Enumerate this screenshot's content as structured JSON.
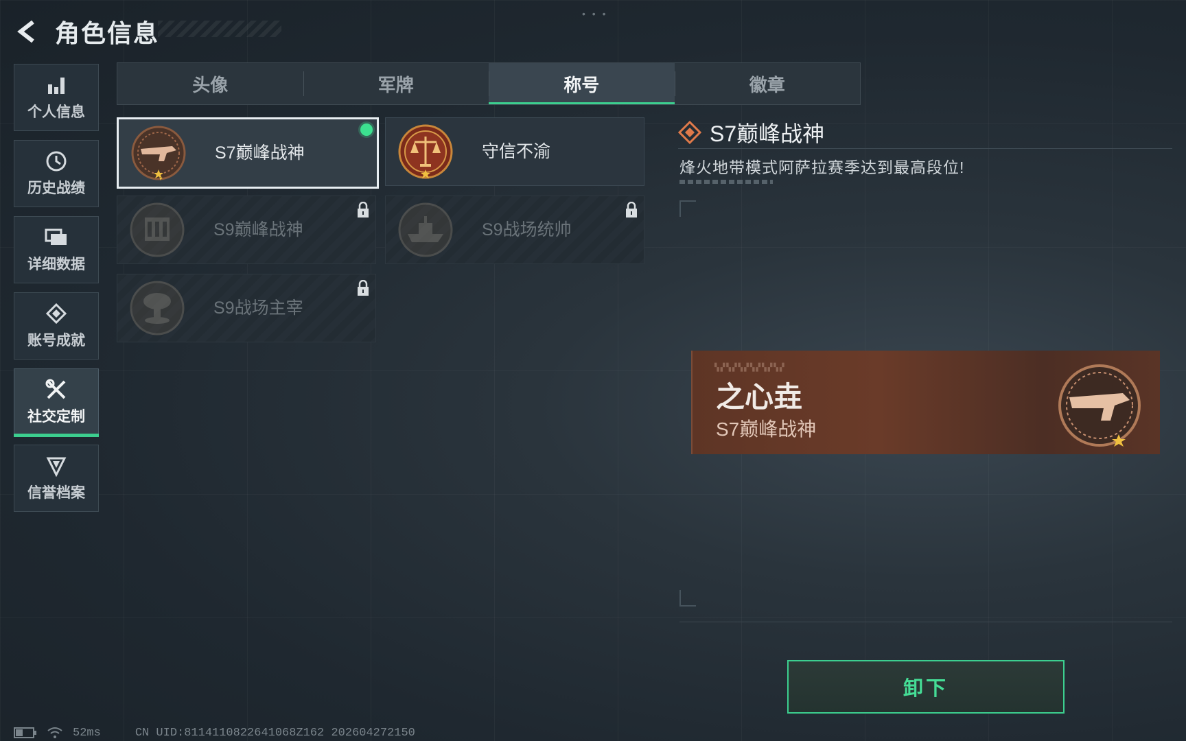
{
  "header": {
    "title": "角色信息"
  },
  "sidebar": {
    "items": [
      {
        "label": "个人信息",
        "icon": "bar-chart-icon",
        "active": false
      },
      {
        "label": "历史战绩",
        "icon": "clock-icon",
        "active": false
      },
      {
        "label": "详细数据",
        "icon": "folder-icon",
        "active": false
      },
      {
        "label": "账号成就",
        "icon": "achievement-icon",
        "active": false
      },
      {
        "label": "社交定制",
        "icon": "tools-icon",
        "active": true
      },
      {
        "label": "信誉档案",
        "icon": "shield-icon",
        "active": false
      }
    ]
  },
  "tabs": [
    {
      "label": "头像",
      "active": false
    },
    {
      "label": "军牌",
      "active": false
    },
    {
      "label": "称号",
      "active": true
    },
    {
      "label": "徽章",
      "active": false
    }
  ],
  "titles": [
    {
      "name": "S7巅峰战神",
      "icon": "weapon-badge-icon",
      "selected": true,
      "equipped": true,
      "locked": false
    },
    {
      "name": "守信不渝",
      "icon": "scales-badge-icon",
      "selected": false,
      "equipped": false,
      "locked": false
    },
    {
      "name": "S9巅峰战神",
      "icon": "building-badge-icon",
      "selected": false,
      "equipped": false,
      "locked": true
    },
    {
      "name": "S9战场统帅",
      "icon": "ship-badge-icon",
      "selected": false,
      "equipped": false,
      "locked": true
    },
    {
      "name": "S9战场主宰",
      "icon": "explosion-badge-icon",
      "selected": false,
      "equipped": false,
      "locked": true
    }
  ],
  "detail": {
    "title": "S7巅峰战神",
    "description": "烽火地带模式阿萨拉赛季达到最高段位!"
  },
  "preview": {
    "player_name": "之心垚",
    "title": "S7巅峰战神"
  },
  "actions": {
    "unequip_label": "卸下"
  },
  "status_bar": {
    "ping": "52ms",
    "uid": "CN UID:8114110822641068Z162 202604272150"
  },
  "colors": {
    "accent": "#3ccf8f",
    "preview_bg": "#6a3b29",
    "detail_icon": "#e07a4a"
  }
}
